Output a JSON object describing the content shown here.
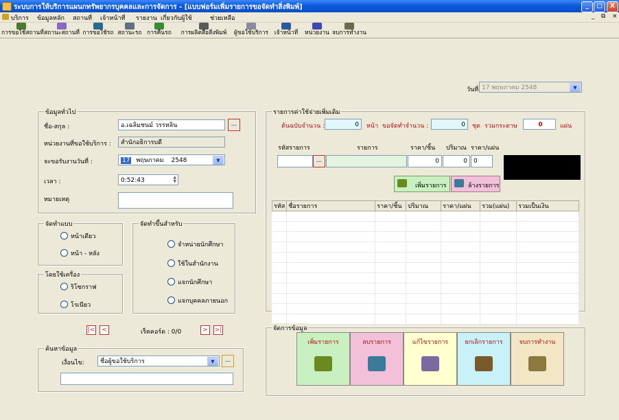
{
  "window": {
    "title": "ระบบการให้บริการแผนกทรัพยากรบุคคลและการจัดการ - [แบบฟอร์มเพิ่มรายการขอจัดทำสิ่งพิมพ์]",
    "minimize": "_",
    "maximize": "□",
    "close": "X"
  },
  "menu": {
    "items": [
      "บริการ",
      "ข้อมูลหลัก",
      "สถานที่",
      "เจ้าหน้าที่",
      "รายงาน",
      "เกี่ยวกับผู้ใช้",
      "ช่วยเหลือ"
    ],
    "mdi_min": "_",
    "mdi_restore": "⧉",
    "mdi_close": "×"
  },
  "toolbar": {
    "items": [
      "การขอใช้สถานที่",
      "สถานะสถานที่",
      "การขอใช้รถ",
      "สถานะรถ",
      "การคืนรถ",
      "การผลิตสื่อสิ่งพิมพ์",
      "ผู้ขอใช้บริการ",
      "เจ้าหน้าที่",
      "หน่วยงาน",
      "จบการทำงาน"
    ]
  },
  "date": {
    "label": "วันที่:",
    "value": "17  พฤษภาคม  2548"
  },
  "general": {
    "title": "ข้อมูลทั่วไป",
    "name_label": "ชื่อ-สกุล :",
    "name_value": "อ.เฉลิมชนม์  วรรหลิน",
    "dept_label": "หน่วยงานที่ขอใช้บริการ :",
    "dept_value": "สำนักอธิการบดี",
    "due_label": "จะขอรับงานวันที่ :",
    "due_day": "17",
    "due_month": "พฤษภาคม",
    "due_year": "2548",
    "time_label": "เวลา :",
    "time_value": "0:52:43",
    "note_label": "หมายเหตุ",
    "browse": "..."
  },
  "layout": {
    "title": "จัดทำแบบ",
    "options": [
      "หน้าเดียว",
      "หน้า - หลัง"
    ]
  },
  "purpose": {
    "title": "จัดทำขึ้นสำหรับ",
    "options": [
      "จำหน่ายนักศึกษา",
      "ใช้ในสำนักงาน",
      "แจกนักศึกษา",
      "แจกบุคคลภายนอก"
    ]
  },
  "machine": {
    "title": "โดยใช้เครื่อง",
    "options": [
      "ริโซกราฟ",
      "โรเนียว"
    ]
  },
  "nav": {
    "first": "|<",
    "prev": "<",
    "record": "เร็คคอร์ด : 0/0",
    "next": ">",
    "last": ">|"
  },
  "search": {
    "title": "ค้นหาข้อมูล",
    "cond_label": "เงื่อนไข:",
    "cond_value": "ชื่อผู้ขอใช้บริการ"
  },
  "expense": {
    "title": "รายการค่าใช้จ่ายเพิ่มเติม",
    "orig_label": "ต้นฉบับจำนวน :",
    "orig_value": "0",
    "pages_unit": "หน้า",
    "sets_label": "ขอจัดทำจำนวน :",
    "sets_value": "0",
    "sets_unit": "ชุด",
    "total_label": "รวมกระดาษ",
    "total_value": "0",
    "sheet_unit": "แผ่น",
    "col_code": "รหัสรายการ",
    "col_item": "รายการ",
    "col_price": "ราคา/ชิ้น",
    "col_qty": "ปริมาณ",
    "col_sheet": "ราคา/แผ่น",
    "price_value": "0",
    "qty_value": "0",
    "sheet_value": "0",
    "add_btn": "เพิ่มรายการ",
    "clear_btn": "ล้างรายการ"
  },
  "grid": {
    "headers": [
      "รหัส",
      "ชื่อรายการ",
      "ราคา/ชิ้น",
      "ปริมาณ",
      "ราคา/แผ่น",
      "รวม(แผ่น)",
      "รวมเป็นเงิน"
    ]
  },
  "manage": {
    "title": "จัดการข้อมูล",
    "buttons": [
      {
        "label": "เพิ่มรายการ",
        "color": "#c8f0c0",
        "icon_color": "#6a8a20",
        "icon": "pencil-icon"
      },
      {
        "label": "ลบรายการ",
        "color": "#f2c0d8",
        "icon_color": "#3c7a9a",
        "icon": "trash-icon"
      },
      {
        "label": "แก้ไขรายการ",
        "color": "#ffffd0",
        "icon_color": "#7a6aa0",
        "icon": "edit-icon"
      },
      {
        "label": "ยกเลิกรายการ",
        "color": "#c8f2f8",
        "icon_color": "#7a5a2a",
        "icon": "cancel-icon"
      },
      {
        "label": "จบการทำงาน",
        "color": "#f2e6c4",
        "icon_color": "#8a7a40",
        "icon": "alarm-clock-icon"
      }
    ]
  },
  "colors": {
    "accent": "#0a5bde",
    "nav_red": "#c03030",
    "label_red": "#b01010"
  }
}
